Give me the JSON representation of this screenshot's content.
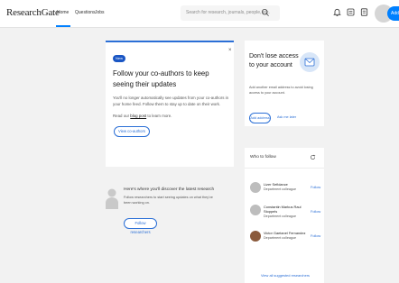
{
  "header": {
    "logo": "ResearchGate",
    "nav": [
      "Home",
      "Questions",
      "Jobs"
    ],
    "search_placeholder": "Search for research, journals, people, etc.",
    "add_label": "Add",
    "accent": "#0080ff"
  },
  "coauthors_card": {
    "badge": "New",
    "close": "×",
    "title": "Follow your co-authors to keep seeing their updates",
    "description": "You'll no longer automatically see updates from your co-authors in your home feed. Follow them to stay up to date on their work.",
    "read_prefix": "Read our ",
    "read_link": "blog post",
    "read_suffix": " to learn more.",
    "button": "View co-authors"
  },
  "discover_card": {
    "title": "Here's where you'll discover the latest research",
    "description": "Follow researchers to start seeing updates on what they've been working on.",
    "button": "Follow researchers"
  },
  "access_card": {
    "title": "Don't lose access to your account",
    "description": "Add another email address to avoid losing access to your account.",
    "add_button": "Add address",
    "ask_later": "Ask me later"
  },
  "who_to_follow": {
    "title": "Who to follow",
    "people": [
      {
        "name": "Lizer Sefidance",
        "dept": "Department colleague",
        "follow": "Follow"
      },
      {
        "name": "Constantin Markus Raul Stoppels",
        "dept": "Department colleague",
        "follow": "Follow"
      },
      {
        "name": "Victor Gaetanel Fernandez",
        "dept": "Department colleague",
        "follow": "Follow"
      }
    ],
    "view_all": "View all suggested researchers"
  }
}
